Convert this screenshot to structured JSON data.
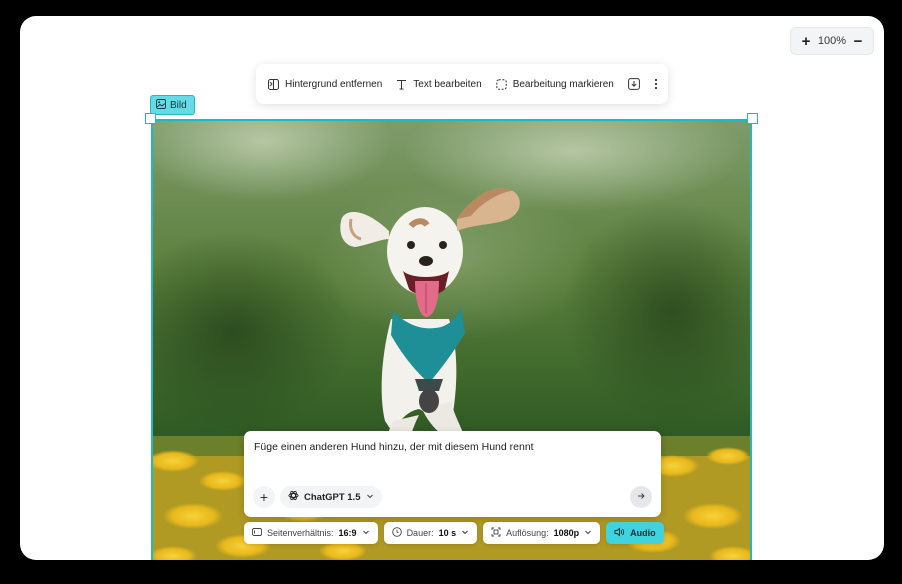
{
  "zoom": {
    "plus_label": "+",
    "minus_label": "−",
    "level": "100%"
  },
  "toolbar": {
    "remove_bg": "Hintergrund entfernen",
    "edit_text": "Text bearbeiten",
    "mark_edit": "Bearbeitung markieren"
  },
  "canvas": {
    "selection_label": "Bild",
    "accent_color": "#22b7c5"
  },
  "prompt": {
    "text": "Füge einen anderen Hund hinzu, der mit diesem Hund rennt",
    "add_label": "+",
    "model": "ChatGPT 1.5"
  },
  "settings": {
    "aspect_label": "Seitenverhältnis:",
    "aspect_value": "16:9",
    "duration_label": "Dauer:",
    "duration_value": "10 s",
    "resolution_label": "Auflösung:",
    "resolution_value": "1080p",
    "audio_label": "Audio"
  }
}
